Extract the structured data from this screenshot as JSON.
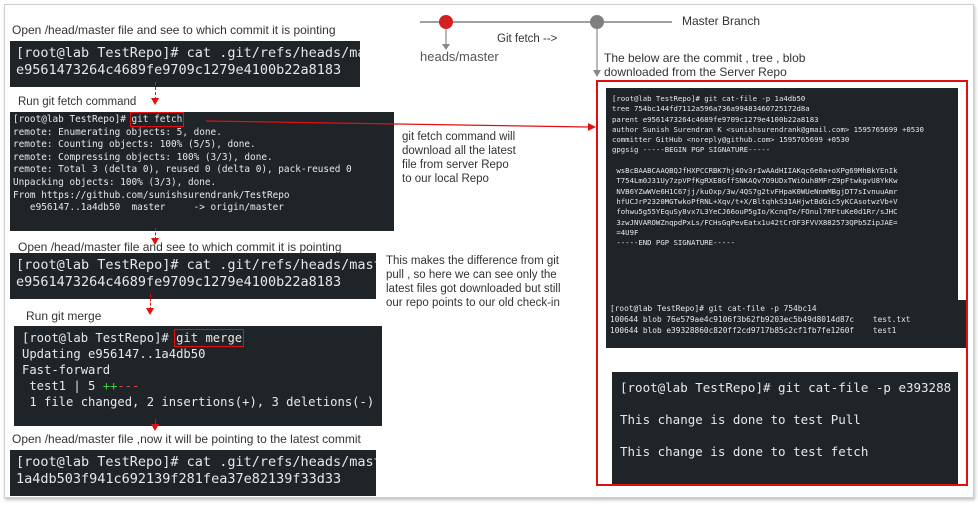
{
  "diagram": {
    "branch_label": "Master Branch",
    "fetch_label": "Git fetch -->",
    "head_label": "heads/master",
    "colors": {
      "head_dot": "#d42020",
      "commit_dot": "#7f7f7f",
      "line": "#a0a0a0",
      "highlight": "#e01010",
      "terminal_bg": "#1f2428"
    }
  },
  "steps": {
    "step1_label": "Open  /head/master file and see to which commit it is pointing",
    "step2_label": "Run git fetch command",
    "step3_label": "Open  /head/master file and see to which commit it is pointing",
    "step4_label": "Run git merge",
    "step5_label": "Open  /head/master file ,now it will be pointing to the latest commit",
    "right_label_1": "The below are the commit , tree , blob",
    "right_label_2": "downloaded from the Server Repo"
  },
  "notes": {
    "fetch_note": [
      "git fetch command will",
      "download all the latest",
      "file from server Repo",
      "to our local Repo"
    ],
    "diff_note": [
      "This makes the difference from git",
      "pull , so here we can see only the",
      "latest files got downloaded but still",
      "our repo points to our old check-in"
    ]
  },
  "terminals": {
    "cat1": {
      "prompt": "[root@lab TestRepo]# cat .git/refs/heads/master",
      "output": "e9561473264c4689fe9709c1279e4100b22a8183"
    },
    "fetch": {
      "prompt": "[root@lab TestRepo]# ",
      "command": "git fetch",
      "lines": [
        "remote: Enumerating objects: 5, done.",
        "remote: Counting objects: 100% (5/5), done.",
        "remote: Compressing objects: 100% (3/3), done.",
        "remote: Total 3 (delta 0), reused 0 (delta 0), pack-reused 0",
        "Unpacking objects: 100% (3/3), done.",
        "From https://github.com/sunishsurendrank/TestRepo",
        "   e956147..1a4db50  master     -> origin/master"
      ]
    },
    "cat2": {
      "prompt": "[root@lab TestRepo]# cat .git/refs/heads/master",
      "output": "e9561473264c4689fe9709c1279e4100b22a8183"
    },
    "merge": {
      "prompt": "[root@lab TestRepo]# ",
      "command": "git merge",
      "line1": "Updating e956147..1a4db50",
      "line2": "Fast-forward",
      "stat_prefix": " test1 | 5 ",
      "stat_plus": "++",
      "stat_minus": "---",
      "summary": " 1 file changed, 2 insertions(+), 3 deletions(-)"
    },
    "cat3": {
      "prompt": "[root@lab TestRepo]# cat .git/refs/heads/master",
      "output": "1a4db503f941c692139f281fea37e82139f33d33"
    },
    "commit": {
      "lines": [
        "[root@lab TestRepo]# git cat-file -p 1a4db50",
        "tree 754bc144fd7112a596a736a99483460725172d8a",
        "parent e9561473264c4689fe9709c1279e4100b22a8183",
        "author Sunish Surendran K <sunishsurendrank@gmail.com> 1595765699 +0530",
        "committer GitHub <noreply@github.com> 1595765699 +0530",
        "gpgsig -----BEGIN PGP SIGNATURE-----",
        "",
        " wsBcBAABCAAQBQJfHXPCCRBK7hj4Ov3rIwAAdHIIAKqc6e0a+oXPg69MhBkYEnIk",
        " T754Lm0J31Uy7zpVPfKgRXE8GffSNKAQv7O9UDxTWiOuh8MFrZ9pFtwkgvU8YkKw",
        " NVB6YZwWVe6H1C67jj/kuOxp/3w/4QS7g2tvFHpaK0WUeNnmMBgjDT7sIvnuuAmr",
        " hfUCJrP2320MGTwkoPfRNL+Xqv/t+X/BltqhkS31AHjwtBdGic5yKCAsotwzVb+V",
        " fohwu5g55YEquSy8vx7L3YeCJ66ouP5gIo/KcnqTe/FOnul7RFtuKe0d1Rr/sJHC",
        " 3zwJNVAROWZnqpdPxLs/FCHsGqPevEatx1u42tCrOF3FVVX882573QPb5ZipJAE=",
        " =4U9F",
        " -----END PGP SIGNATURE-----"
      ]
    },
    "tree": {
      "prompt": "[root@lab TestRepo]# git cat-file -p 754bc14",
      "rows": [
        {
          "mode": "100644",
          "type": "blob",
          "hash": "76e579ae4c9106f3b62fb9203ec5b49d8014d87c",
          "name": "test.txt"
        },
        {
          "mode": "100644",
          "type": "blob",
          "hash": "e39328860c820ff2cd9717b85c2cf1fb7fe1260f",
          "name": "test1"
        }
      ]
    },
    "blob": {
      "prompt": "[root@lab TestRepo]# git cat-file -p e393288",
      "line1": "This change is done to test Pull",
      "line2": "This change is done to test fetch"
    }
  }
}
